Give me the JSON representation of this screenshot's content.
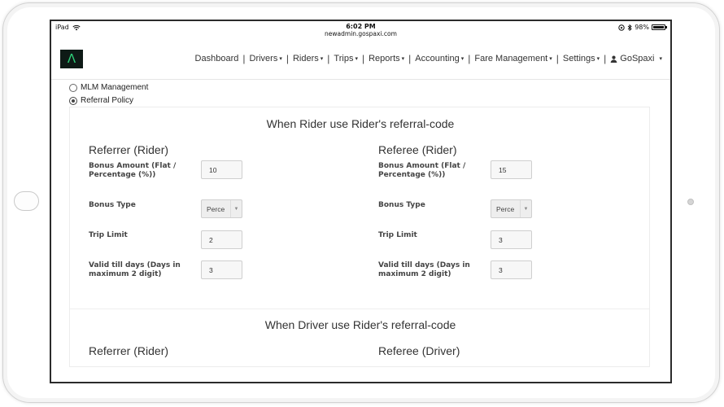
{
  "status_bar": {
    "device": "iPad",
    "time": "6:02 PM",
    "url": "newadmin.gospaxi.com",
    "battery": "98%",
    "battery_level": 0.98
  },
  "nav": {
    "items": [
      {
        "label": "Dashboard",
        "dropdown": false
      },
      {
        "label": "Drivers",
        "dropdown": true
      },
      {
        "label": "Riders",
        "dropdown": true
      },
      {
        "label": "Trips",
        "dropdown": true
      },
      {
        "label": "Reports",
        "dropdown": true
      },
      {
        "label": "Accounting",
        "dropdown": true
      },
      {
        "label": "Fare Management",
        "dropdown": true
      },
      {
        "label": "Settings",
        "dropdown": true
      }
    ],
    "user": "GoSpaxi",
    "caret": "▾",
    "separator": "|"
  },
  "policy_options": [
    {
      "label": "MLM Management",
      "selected": false
    },
    {
      "label": "Referral Policy",
      "selected": true
    }
  ],
  "sections": [
    {
      "title": "When Rider use Rider's referral-code",
      "referrer": {
        "heading": "Referrer (Rider)",
        "bonus_amount_label": "Bonus Amount (Flat / Percentage (%))",
        "bonus_amount": "10",
        "bonus_type_label": "Bonus Type",
        "bonus_type": "Perce",
        "trip_limit_label": "Trip Limit",
        "trip_limit": "2",
        "valid_days_label": "Valid till days (Days in maximum 2 digit)",
        "valid_days": "3"
      },
      "referee": {
        "heading": "Referee (Rider)",
        "bonus_amount_label": "Bonus Amount (Flat / Percentage (%))",
        "bonus_amount": "15",
        "bonus_type_label": "Bonus Type",
        "bonus_type": "Perce",
        "trip_limit_label": "Trip Limit",
        "trip_limit": "3",
        "valid_days_label": "Valid till days (Days in maximum 2 digit)",
        "valid_days": "3"
      }
    },
    {
      "title": "When Driver use Rider's referral-code",
      "referrer": {
        "heading": "Referrer (Rider)"
      },
      "referee": {
        "heading": "Referee (Driver)"
      }
    }
  ]
}
